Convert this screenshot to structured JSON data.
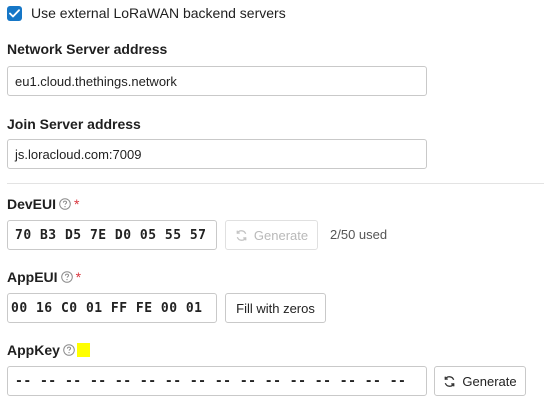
{
  "backend": {
    "use_external_label": "Use external LoRaWAN backend servers",
    "checked": true
  },
  "network_server": {
    "label": "Network Server address",
    "value": "eu1.cloud.thethings.network"
  },
  "join_server": {
    "label": "Join Server address",
    "value": "js.loracloud.com:7009"
  },
  "dev_eui": {
    "label": "DevEUI",
    "required_mark": "*",
    "value": "70 B3 D5 7E D0 05 55 57",
    "generate_label": "Generate",
    "usage": "2/50 used"
  },
  "app_eui": {
    "label": "AppEUI",
    "required_mark": "*",
    "value": "00 16 C0 01 FF FE 00 01",
    "fill_zeros_label": "Fill with zeros"
  },
  "app_key": {
    "label": "AppKey",
    "value": "-- -- -- -- -- -- -- -- -- -- -- -- -- -- -- --",
    "generate_label": "Generate"
  },
  "colors": {
    "accent": "#1677c7",
    "required": "#d9363e",
    "highlight": "#ffff00",
    "disabled_text": "#b9b9b9"
  },
  "icons": {
    "checkbox": "check-icon",
    "help": "question-circle-icon",
    "generate": "refresh-icon"
  }
}
